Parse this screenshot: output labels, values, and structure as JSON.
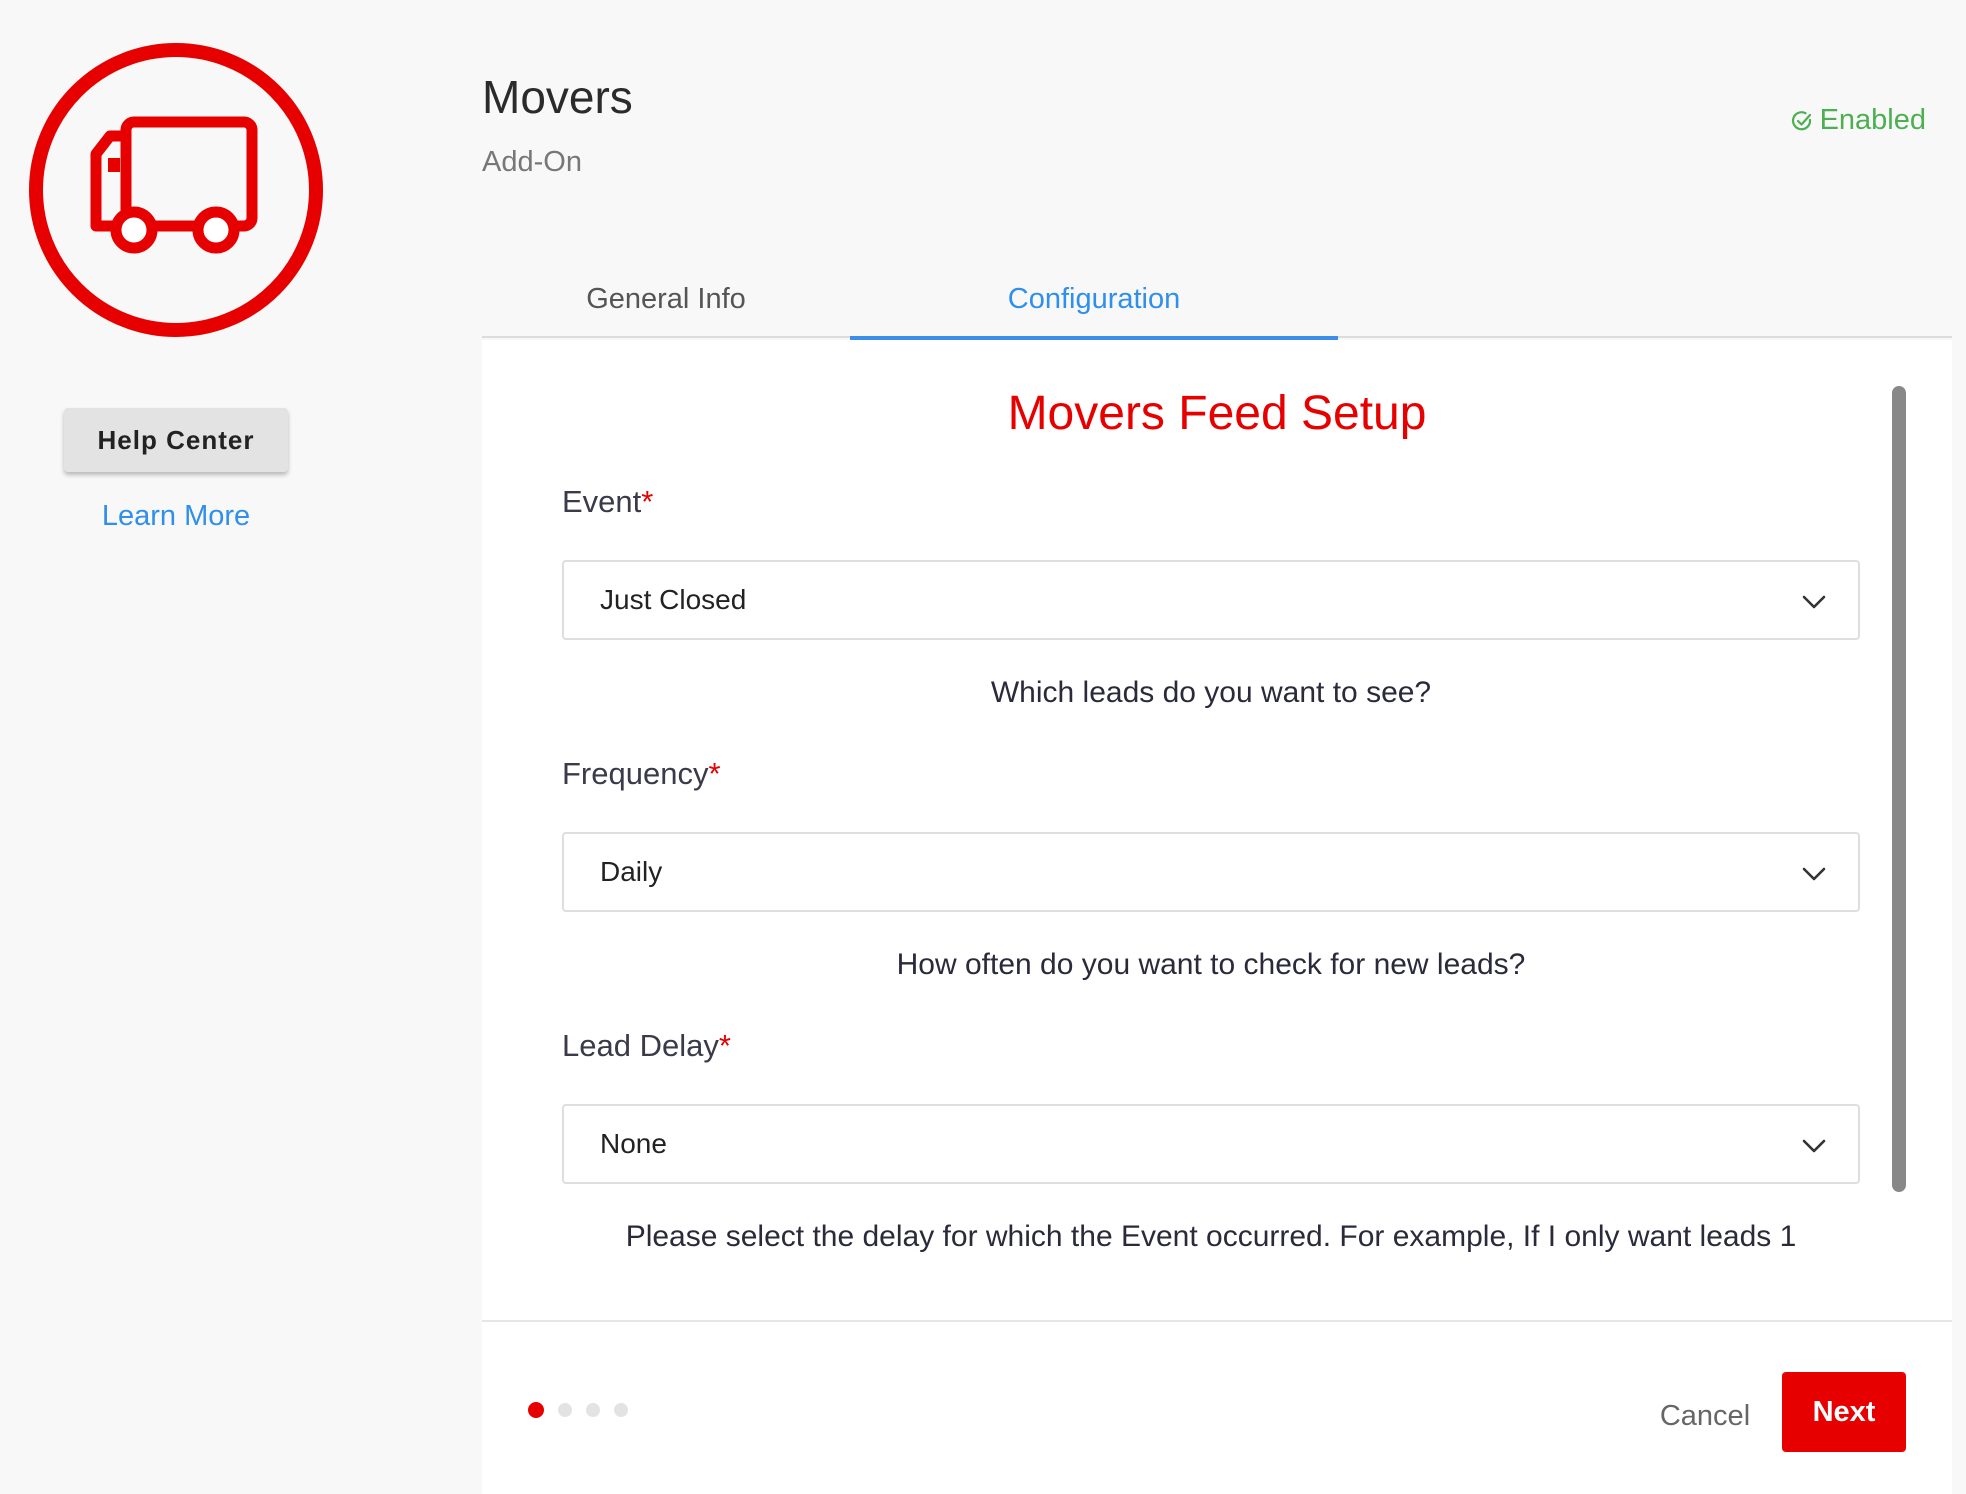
{
  "app": {
    "title": "Movers",
    "subtitle": "Add-On",
    "status": "Enabled",
    "brand_color": "#e60000",
    "accent_color": "#2f8fea",
    "status_color": "#4caf50",
    "logo_icon": "truck-icon"
  },
  "sidebar": {
    "help_button": "Help Center",
    "learn_more": "Learn More"
  },
  "tabs": [
    {
      "label": "General Info",
      "active": false
    },
    {
      "label": "Configuration",
      "active": true
    }
  ],
  "form": {
    "title": "Movers Feed Setup",
    "required_marker": "*",
    "fields": [
      {
        "label": "Event",
        "value": "Just Closed",
        "hint": "Which leads do you want to see?"
      },
      {
        "label": "Frequency",
        "value": "Daily",
        "hint": "How often do you want to check for new leads?"
      },
      {
        "label": "Lead Delay",
        "value": "None",
        "hint": "Please select the delay for which the Event occurred. For example, If I only want leads 1"
      }
    ]
  },
  "footer": {
    "steps_total": 4,
    "current_step": 1,
    "cancel_label": "Cancel",
    "next_label": "Next"
  }
}
